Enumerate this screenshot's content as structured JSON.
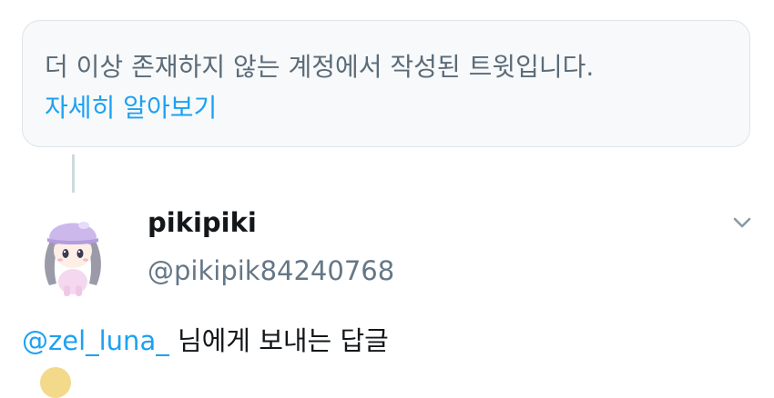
{
  "notice": {
    "text": "더 이상 존재하지 않는 계정에서 작성된 트윗입니다.",
    "link": "자세히 알아보기"
  },
  "tweet": {
    "display_name": "pikipiki",
    "handle": "@pikipik84240768",
    "reply_mention": "@zel_luna_",
    "reply_suffix": "님에게 보내는 답글",
    "more_icon": "chevron-down-icon",
    "avatar_icon": "avatar-character-icon"
  },
  "colors": {
    "accent": "#1da1f2",
    "secondary_text": "#657786",
    "primary_text": "#14171a",
    "card_background": "#f7f9fa",
    "card_border": "#dfe4e8"
  }
}
